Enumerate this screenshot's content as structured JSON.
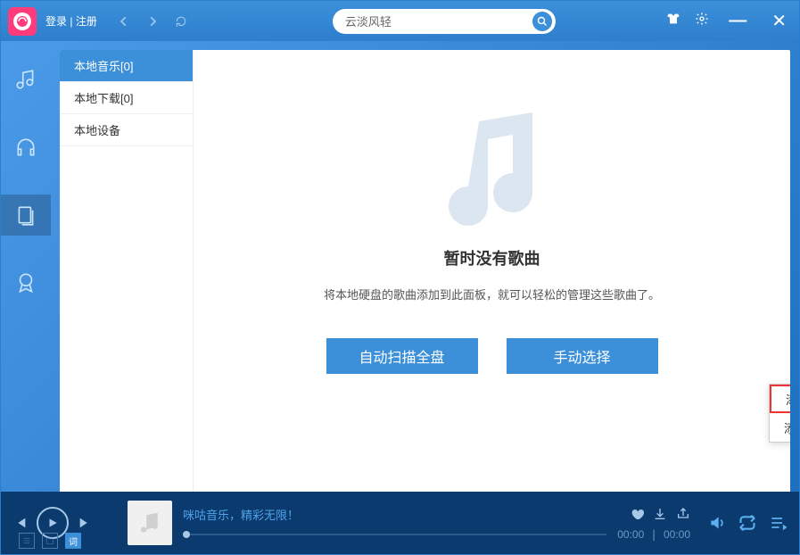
{
  "header": {
    "login": "登录",
    "register": "注册",
    "search_value": "云淡风轻"
  },
  "sidebar": {
    "items": [
      {
        "label": "本地音乐[0]",
        "active": true
      },
      {
        "label": "本地下载[0]",
        "active": false
      },
      {
        "label": "本地设备",
        "active": false
      }
    ]
  },
  "main": {
    "empty_title": "暂时没有歌曲",
    "empty_desc": "将本地硬盘的歌曲添加到此面板，就可以轻松的管理这些歌曲了。",
    "scan_btn": "自动扫描全盘",
    "manual_btn": "手动选择"
  },
  "popup": {
    "items": [
      {
        "label": "添加本地文件",
        "highlighted": true
      },
      {
        "label": "添加本地文件夹",
        "highlighted": false
      }
    ]
  },
  "footer": {
    "tagline": "咪咕音乐，精彩无限！",
    "time_current": "00:00",
    "time_total": "00:00",
    "lyric_label": "词"
  }
}
